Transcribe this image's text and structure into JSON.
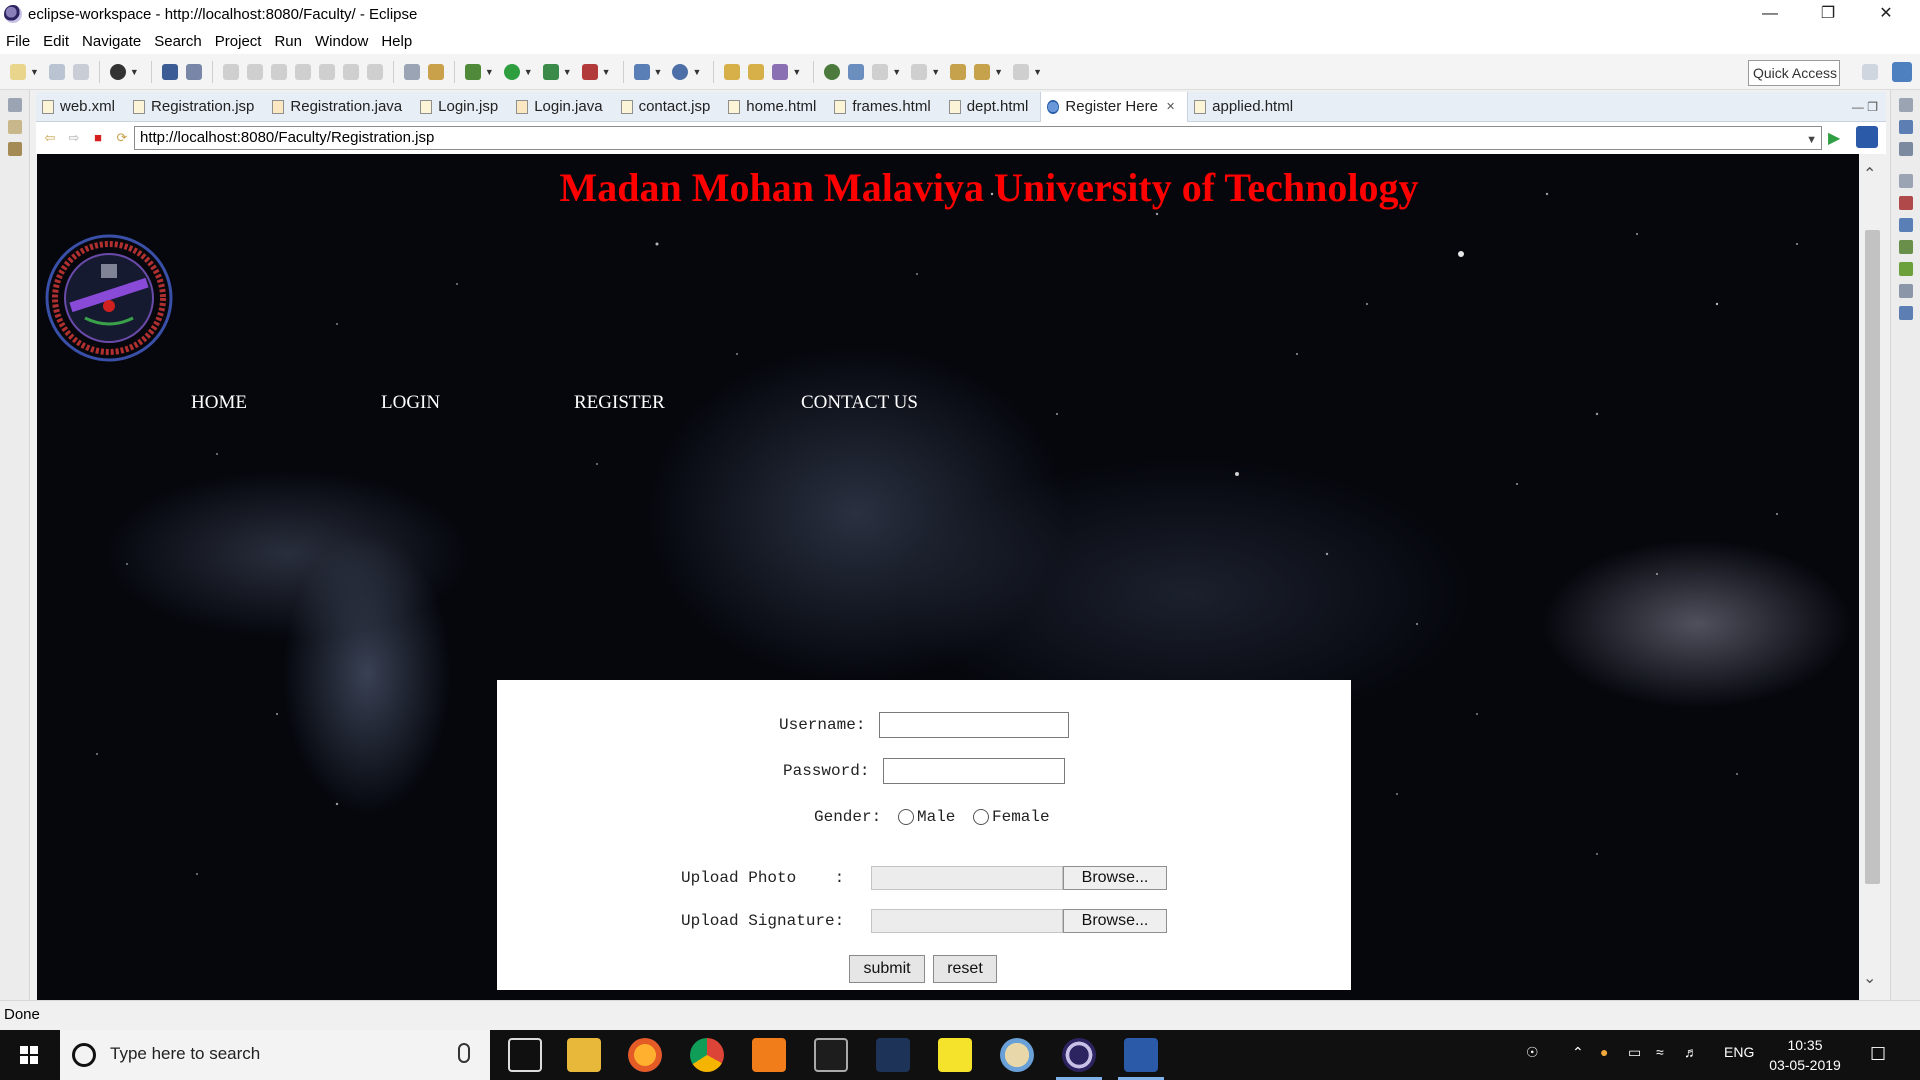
{
  "window": {
    "title": "eclipse-workspace - http://localhost:8080/Faculty/ - Eclipse"
  },
  "menu": [
    "File",
    "Edit",
    "Navigate",
    "Search",
    "Project",
    "Run",
    "Window",
    "Help"
  ],
  "toolbar": {
    "quick_access": "Quick Access"
  },
  "tabs": [
    {
      "label": "web.xml",
      "active": false
    },
    {
      "label": "Registration.jsp",
      "active": false
    },
    {
      "label": "Registration.java",
      "active": false
    },
    {
      "label": "Login.jsp",
      "active": false
    },
    {
      "label": "Login.java",
      "active": false
    },
    {
      "label": "contact.jsp",
      "active": false
    },
    {
      "label": "home.html",
      "active": false
    },
    {
      "label": "frames.html",
      "active": false
    },
    {
      "label": "dept.html",
      "active": false
    },
    {
      "label": "Register Here",
      "active": true
    },
    {
      "label": "applied.html",
      "active": false
    }
  ],
  "browser": {
    "url": "http://localhost:8080/Faculty/Registration.jsp"
  },
  "page": {
    "title": "Madan Mohan Malaviya University of Technology",
    "nav": [
      "HOME",
      "LOGIN",
      "REGISTER",
      "CONTACT US"
    ],
    "form": {
      "username_label": "Username:",
      "password_label": "Password:",
      "gender_label": "Gender:",
      "gender_options": [
        "Male",
        "Female"
      ],
      "photo_label": "Upload Photo    :",
      "signature_label": "Upload Signature:",
      "browse_label": "Browse...",
      "submit_label": "submit",
      "reset_label": "reset"
    }
  },
  "status": {
    "text": "Done"
  },
  "taskbar": {
    "search_placeholder": "Type here to search",
    "language": "ENG",
    "time": "10:35",
    "date": "03-05-2019"
  },
  "colors": {
    "title_red": "#ff0000",
    "page_background": "#05070d",
    "tab_bar": "#e8eef6"
  }
}
